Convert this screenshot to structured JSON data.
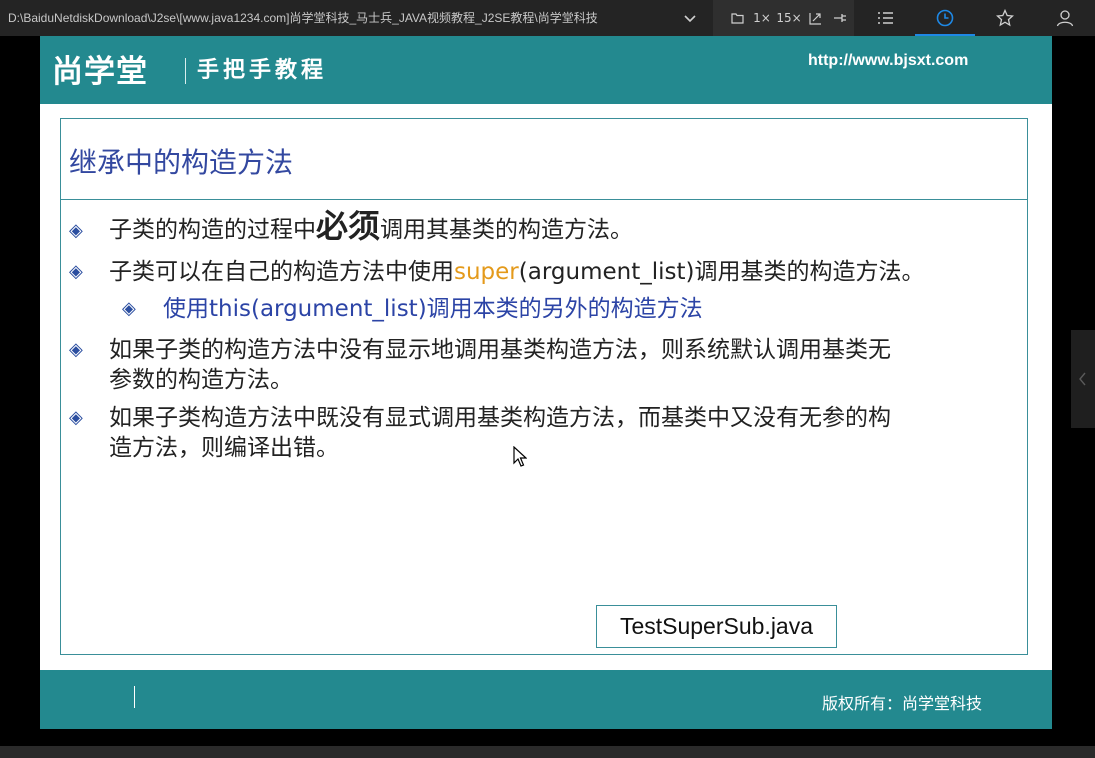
{
  "player": {
    "title": "D:\\BaiduNetdiskDownload\\J2se\\[www.java1234.com]尚学堂科技_马士兵_JAVA视频教程_J2SE教程\\尚学堂科技",
    "speed_1x": "1×",
    "speed_15x": "15×",
    "icons": [
      "chevron-down-icon",
      "folder-icon",
      "screenshot-icon",
      "pin-icon",
      "playlist-icon",
      "history-icon",
      "star-icon",
      "user-icon"
    ],
    "accent_color": "#1e88e5"
  },
  "slide": {
    "logo": "尚学堂",
    "subtitle": "手把手教程",
    "url": "http://www.bjsxt.com",
    "title": "继承中的构造方法",
    "bullet1": {
      "pre": "子类的构造的过程中",
      "emph": "必须",
      "post": "调用其基类的构造方法。"
    },
    "bullet2": {
      "pre": "子类可以在自己的构造方法中使用",
      "kw": "super",
      "post": "(argument_list)调用基类的构造方法。"
    },
    "bullet2_sub": "使用this(argument_list)调用本类的另外的构造方法",
    "bullet3": {
      "line1": "如果子类的构造方法中没有显示地调用基类构造方法，则系统默认调用基类无",
      "line2": "参数的构造方法。"
    },
    "bullet4": {
      "line1": "如果子类构造方法中既没有显式调用基类构造方法，而基类中又没有无参的构",
      "line2": "造方法，则编译出错。"
    },
    "file_label": "TestSuperSub.java",
    "footer": "版权所有：尚学堂科技",
    "colors": {
      "header": "#23898f",
      "title": "#3348a0",
      "keyword": "#e49a1b",
      "sub": "#2c44a6"
    }
  }
}
